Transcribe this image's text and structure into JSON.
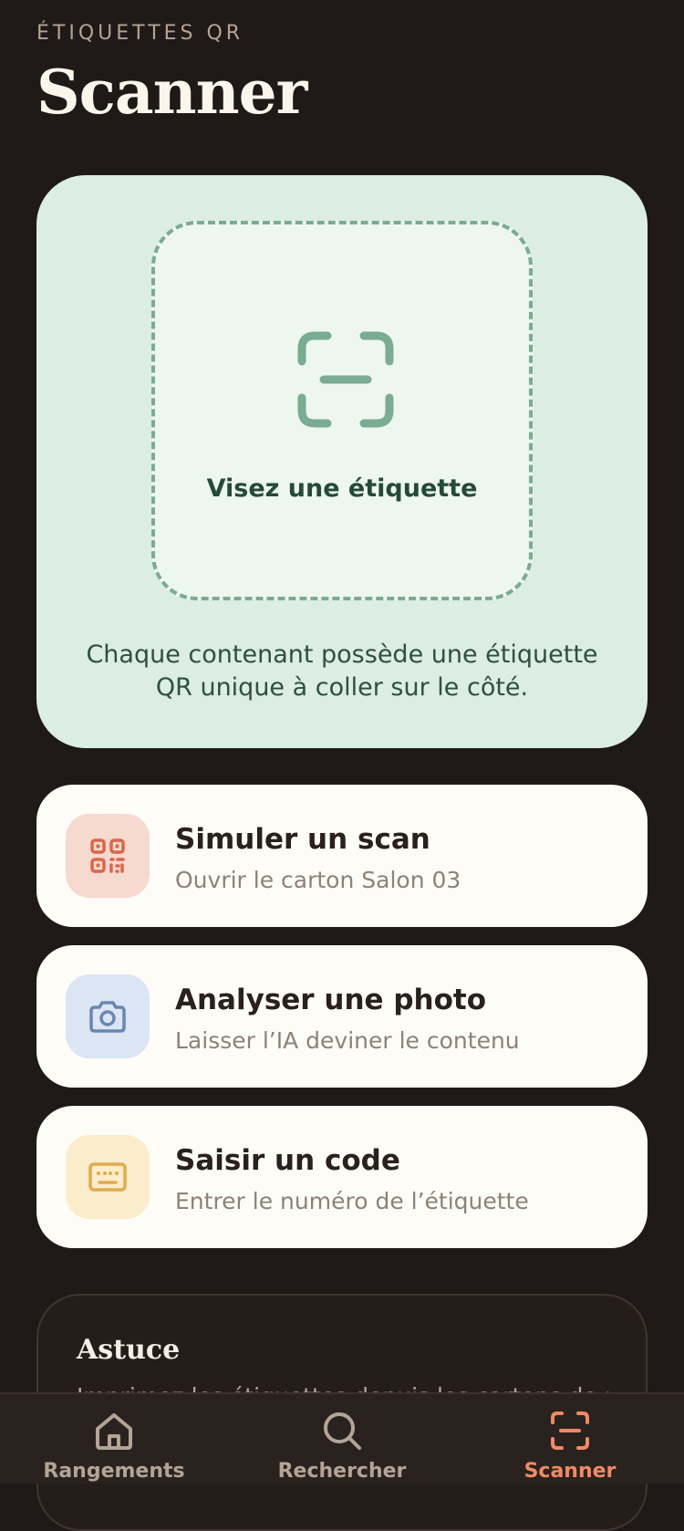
{
  "header": {
    "eyebrow": "ÉTIQUETTES QR",
    "title": "Scanner"
  },
  "scanner": {
    "aim_label": "Visez une étiquette",
    "hint": "Chaque contenant possède une étiquette QR unique à coller sur le côté.",
    "icon": "scan-frame-icon"
  },
  "actions": [
    {
      "label": "Simuler un scan",
      "sub": "Ouvrir le carton Salon 03",
      "icon": "qr-code-icon",
      "icon_bg": "#f6d9cf",
      "icon_color": "#d9674a"
    },
    {
      "label": "Analyser une photo",
      "sub": "Laisser l’IA deviner le contenu",
      "icon": "camera-icon",
      "icon_bg": "#dce5f3",
      "icon_color": "#6a86b3"
    },
    {
      "label": "Saisir un code",
      "sub": "Entrer le numéro de l’étiquette",
      "icon": "keyboard-icon",
      "icon_bg": "#fbeccb",
      "icon_color": "#deac4c"
    }
  ],
  "tip": {
    "title": "Astuce",
    "text": "Imprimez les étiquettes depuis les cartons de rangement"
  },
  "tabbar": {
    "items": [
      {
        "label": "Rangements",
        "icon": "home-icon",
        "active": false
      },
      {
        "label": "Rechercher",
        "icon": "search-icon",
        "active": false
      },
      {
        "label": "Scanner",
        "icon": "scan-icon",
        "active": true
      }
    ]
  },
  "colors": {
    "background": "#1f1917",
    "scan_card": "#dcede3",
    "accent": "#ef8a64",
    "scan_green": "#7aab93"
  }
}
